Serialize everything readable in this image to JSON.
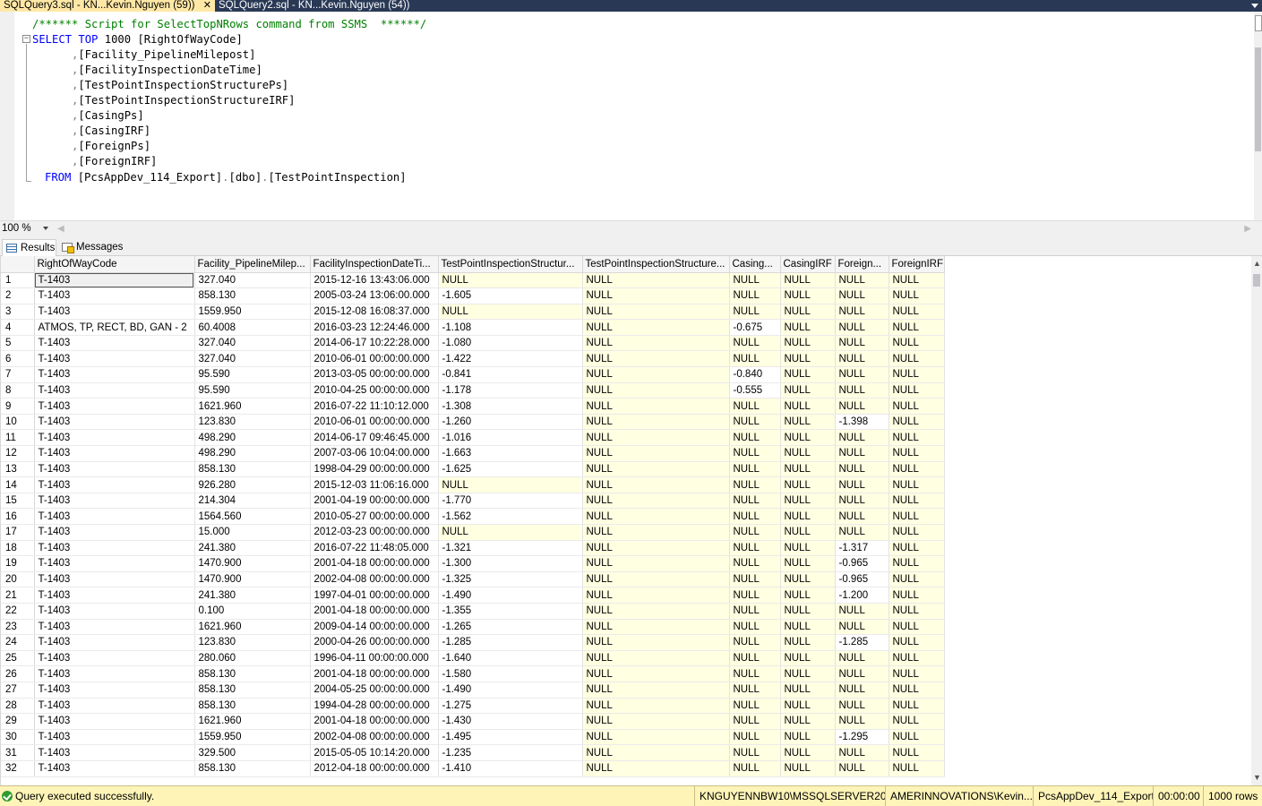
{
  "tabs": [
    {
      "label": "SQLQuery3.sql - KN...Kevin.Nguyen (59))",
      "close": "✕"
    },
    {
      "label": "SQLQuery2.sql - KN...Kevin.Nguyen (54))"
    }
  ],
  "editor": {
    "collapse_glyph": "−",
    "comment": "/****** Script for SelectTopNRows command from SSMS  ******/",
    "select_kw": "SELECT",
    "top_kw": "TOP",
    "top_n": "1000",
    "first_col": "[RightOfWayCode]",
    "comma": ",",
    "columns": [
      "[Facility_PipelineMilepost]",
      "[FacilityInspectionDateTime]",
      "[TestPointInspectionStructurePs]",
      "[TestPointInspectionStructureIRF]",
      "[CasingPs]",
      "[CasingIRF]",
      "[ForeignPs]",
      "[ForeignIRF]"
    ],
    "from_kw": "FROM",
    "from_db": "[PcsAppDev_114_Export]",
    "dot": ".",
    "from_schema": "[dbo]",
    "from_table": "[TestPointInspection]"
  },
  "zoom": {
    "value": "100 %"
  },
  "result_tabs": {
    "results": "Results",
    "messages": "Messages"
  },
  "grid": {
    "headers": [
      "RightOfWayCode",
      "Facility_PipelineMilep...",
      "FacilityInspectionDateTi...",
      "TestPointInspectionStructur...",
      "TestPointInspectionStructure...",
      "Casing...",
      "CasingIRF",
      "Foreign...",
      "ForeignIRF"
    ],
    "rows": [
      [
        "1",
        "T-1403",
        "327.040",
        "2015-12-16 13:43:06.000",
        "NULL",
        "NULL",
        "NULL",
        "NULL",
        "NULL",
        "NULL"
      ],
      [
        "2",
        "T-1403",
        "858.130",
        "2005-03-24 13:06:00.000",
        "-1.605",
        "NULL",
        "NULL",
        "NULL",
        "NULL",
        "NULL"
      ],
      [
        "3",
        "T-1403",
        "1559.950",
        "2015-12-08 16:08:37.000",
        "NULL",
        "NULL",
        "NULL",
        "NULL",
        "NULL",
        "NULL"
      ],
      [
        "4",
        "ATMOS, TP, RECT, BD, GAN - 2",
        "60.4008",
        "2016-03-23 12:24:46.000",
        "-1.108",
        "NULL",
        "-0.675",
        "NULL",
        "NULL",
        "NULL"
      ],
      [
        "5",
        "T-1403",
        "327.040",
        "2014-06-17 10:22:28.000",
        "-1.080",
        "NULL",
        "NULL",
        "NULL",
        "NULL",
        "NULL"
      ],
      [
        "6",
        "T-1403",
        "327.040",
        "2010-06-01 00:00:00.000",
        "-1.422",
        "NULL",
        "NULL",
        "NULL",
        "NULL",
        "NULL"
      ],
      [
        "7",
        "T-1403",
        "95.590",
        "2013-03-05 00:00:00.000",
        "-0.841",
        "NULL",
        "-0.840",
        "NULL",
        "NULL",
        "NULL"
      ],
      [
        "8",
        "T-1403",
        "95.590",
        "2010-04-25 00:00:00.000",
        "-1.178",
        "NULL",
        "-0.555",
        "NULL",
        "NULL",
        "NULL"
      ],
      [
        "9",
        "T-1403",
        "1621.960",
        "2016-07-22 11:10:12.000",
        "-1.308",
        "NULL",
        "NULL",
        "NULL",
        "NULL",
        "NULL"
      ],
      [
        "10",
        "T-1403",
        "123.830",
        "2010-06-01 00:00:00.000",
        "-1.260",
        "NULL",
        "NULL",
        "NULL",
        "-1.398",
        "NULL"
      ],
      [
        "11",
        "T-1403",
        "498.290",
        "2014-06-17 09:46:45.000",
        "-1.016",
        "NULL",
        "NULL",
        "NULL",
        "NULL",
        "NULL"
      ],
      [
        "12",
        "T-1403",
        "498.290",
        "2007-03-06 10:04:00.000",
        "-1.663",
        "NULL",
        "NULL",
        "NULL",
        "NULL",
        "NULL"
      ],
      [
        "13",
        "T-1403",
        "858.130",
        "1998-04-29 00:00:00.000",
        "-1.625",
        "NULL",
        "NULL",
        "NULL",
        "NULL",
        "NULL"
      ],
      [
        "14",
        "T-1403",
        "926.280",
        "2015-12-03 11:06:16.000",
        "NULL",
        "NULL",
        "NULL",
        "NULL",
        "NULL",
        "NULL"
      ],
      [
        "15",
        "T-1403",
        "214.304",
        "2001-04-19 00:00:00.000",
        "-1.770",
        "NULL",
        "NULL",
        "NULL",
        "NULL",
        "NULL"
      ],
      [
        "16",
        "T-1403",
        "1564.560",
        "2010-05-27 00:00:00.000",
        "-1.562",
        "NULL",
        "NULL",
        "NULL",
        "NULL",
        "NULL"
      ],
      [
        "17",
        "T-1403",
        "15.000",
        "2012-03-23 00:00:00.000",
        "NULL",
        "NULL",
        "NULL",
        "NULL",
        "NULL",
        "NULL"
      ],
      [
        "18",
        "T-1403",
        "241.380",
        "2016-07-22 11:48:05.000",
        "-1.321",
        "NULL",
        "NULL",
        "NULL",
        "-1.317",
        "NULL"
      ],
      [
        "19",
        "T-1403",
        "1470.900",
        "2001-04-18 00:00:00.000",
        "-1.300",
        "NULL",
        "NULL",
        "NULL",
        "-0.965",
        "NULL"
      ],
      [
        "20",
        "T-1403",
        "1470.900",
        "2002-04-08 00:00:00.000",
        "-1.325",
        "NULL",
        "NULL",
        "NULL",
        "-0.965",
        "NULL"
      ],
      [
        "21",
        "T-1403",
        "241.380",
        "1997-04-01 00:00:00.000",
        "-1.490",
        "NULL",
        "NULL",
        "NULL",
        "-1.200",
        "NULL"
      ],
      [
        "22",
        "T-1403",
        "0.100",
        "2001-04-18 00:00:00.000",
        "-1.355",
        "NULL",
        "NULL",
        "NULL",
        "NULL",
        "NULL"
      ],
      [
        "23",
        "T-1403",
        "1621.960",
        "2009-04-14 00:00:00.000",
        "-1.265",
        "NULL",
        "NULL",
        "NULL",
        "NULL",
        "NULL"
      ],
      [
        "24",
        "T-1403",
        "123.830",
        "2000-04-26 00:00:00.000",
        "-1.285",
        "NULL",
        "NULL",
        "NULL",
        "-1.285",
        "NULL"
      ],
      [
        "25",
        "T-1403",
        "280.060",
        "1996-04-11 00:00:00.000",
        "-1.640",
        "NULL",
        "NULL",
        "NULL",
        "NULL",
        "NULL"
      ],
      [
        "26",
        "T-1403",
        "858.130",
        "2001-04-18 00:00:00.000",
        "-1.580",
        "NULL",
        "NULL",
        "NULL",
        "NULL",
        "NULL"
      ],
      [
        "27",
        "T-1403",
        "858.130",
        "2004-05-25 00:00:00.000",
        "-1.490",
        "NULL",
        "NULL",
        "NULL",
        "NULL",
        "NULL"
      ],
      [
        "28",
        "T-1403",
        "858.130",
        "1994-04-28 00:00:00.000",
        "-1.275",
        "NULL",
        "NULL",
        "NULL",
        "NULL",
        "NULL"
      ],
      [
        "29",
        "T-1403",
        "1621.960",
        "2001-04-18 00:00:00.000",
        "-1.430",
        "NULL",
        "NULL",
        "NULL",
        "NULL",
        "NULL"
      ],
      [
        "30",
        "T-1403",
        "1559.950",
        "2002-04-08 00:00:00.000",
        "-1.495",
        "NULL",
        "NULL",
        "NULL",
        "-1.295",
        "NULL"
      ],
      [
        "31",
        "T-1403",
        "329.500",
        "2015-05-05 10:14:20.000",
        "-1.235",
        "NULL",
        "NULL",
        "NULL",
        "NULL",
        "NULL"
      ],
      [
        "32",
        "T-1403",
        "858.130",
        "2012-04-18 00:00:00.000",
        "-1.410",
        "NULL",
        "NULL",
        "NULL",
        "NULL",
        "NULL"
      ]
    ]
  },
  "status": {
    "message": "Query executed successfully.",
    "server": "KNGUYENNBW10\\MSSQLSERVER201...",
    "user": "AMERINNOVATIONS\\Kevin....",
    "database": "PcsAppDev_114_Export",
    "elapsed": "00:00:00",
    "rows": "1000 rows"
  }
}
